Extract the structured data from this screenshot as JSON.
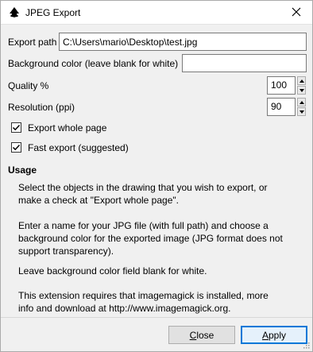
{
  "window": {
    "title": "JPEG Export"
  },
  "form": {
    "export_path_label": "Export path",
    "export_path_value": "C:\\Users\\mario\\Desktop\\test.jpg",
    "bg_color_label": "Background color (leave blank for white)",
    "bg_color_value": "",
    "quality_label": "Quality %",
    "quality_value": "100",
    "resolution_label": "Resolution (ppi)",
    "resolution_value": "90",
    "export_whole_page_label": "Export whole page",
    "export_whole_page_checked": true,
    "fast_export_label": "Fast export (suggested)",
    "fast_export_checked": true
  },
  "usage": {
    "title": "Usage",
    "lines": [
      "Select the objects in the drawing that you wish to export, or",
      "make a check at \"Export whole page\".",
      "Enter a name for your JPG file (with full path) and choose a",
      "background color for the exported image (JPG format does not",
      "support transparency).",
      "Leave background color field blank for white.",
      "This extension requires that imagemagick is installed, more",
      "info and download at http://www.imagemagick.org."
    ]
  },
  "buttons": {
    "close_first": "C",
    "close_rest": "lose",
    "apply_first": "A",
    "apply_rest": "pply"
  },
  "colors": {
    "accent": "#0078d7",
    "window_bg": "#f0f0f0"
  },
  "icons": {
    "app": "inkscape-icon",
    "close": "close-icon",
    "spin_up": "arrow-up-icon",
    "spin_down": "arrow-down-icon",
    "check": "checkmark-icon"
  }
}
